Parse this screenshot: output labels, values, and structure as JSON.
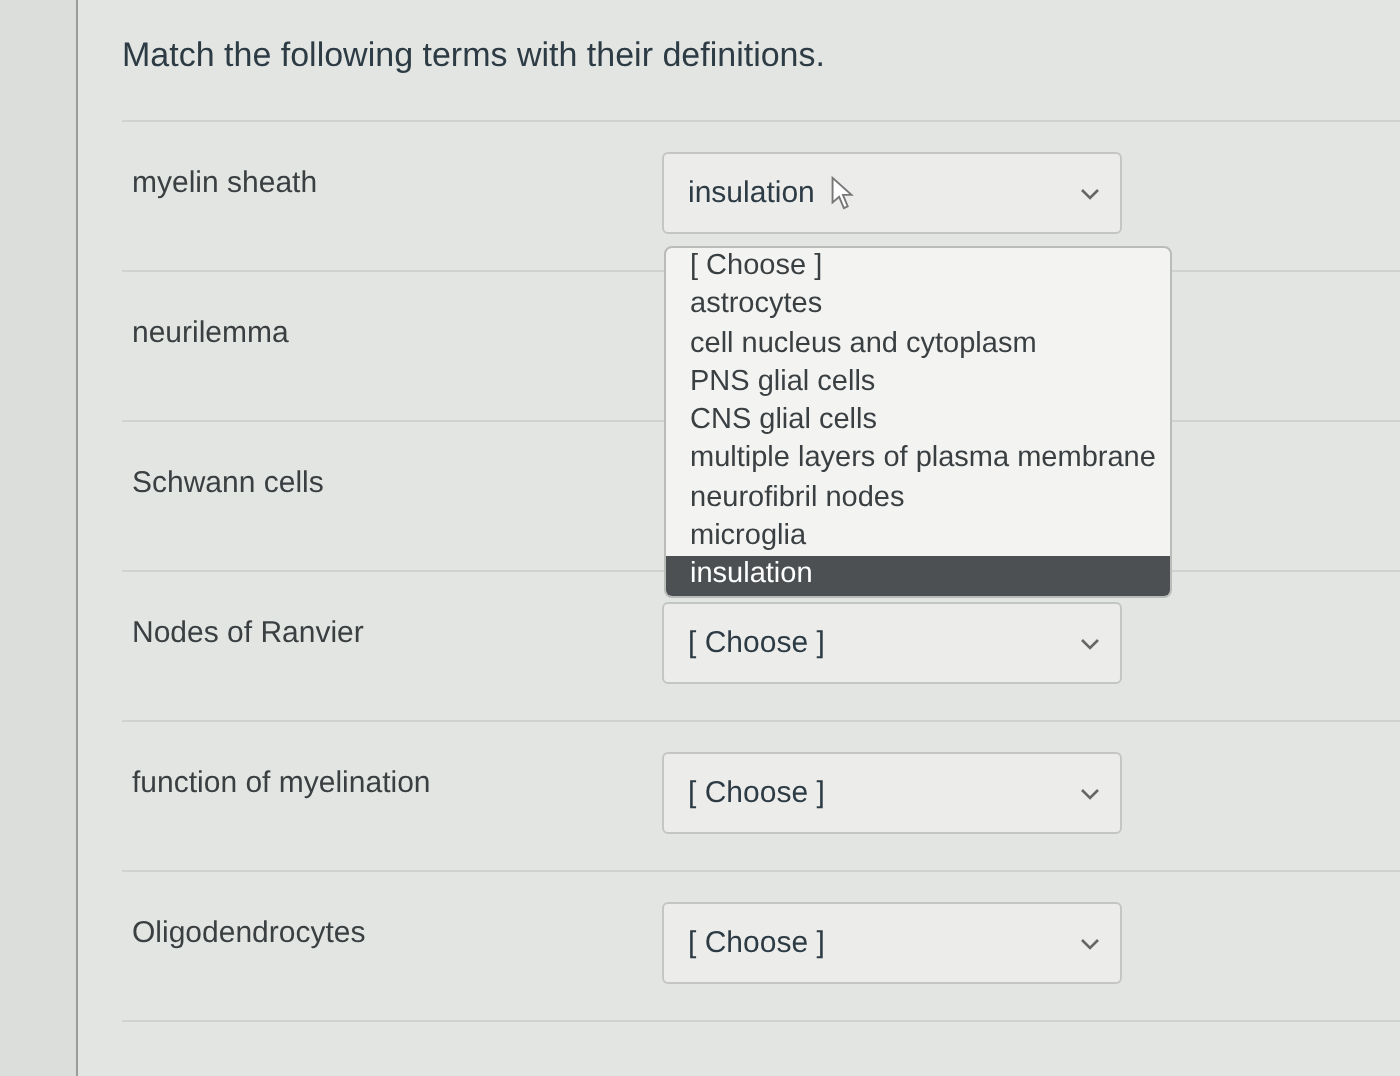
{
  "question": "Match the following terms with their definitions.",
  "rows": [
    {
      "term": "myelin sheath",
      "select": {
        "value": "insulation",
        "open": true,
        "options": [
          {
            "label": "[ Choose ]",
            "selected": false
          },
          {
            "label": "astrocytes",
            "selected": false
          },
          {
            "label": "cell nucleus and cytoplasm",
            "selected": false
          },
          {
            "label": "PNS glial cells",
            "selected": false
          },
          {
            "label": "CNS glial cells",
            "selected": false
          },
          {
            "label": "multiple layers of plasma membrane",
            "selected": false
          },
          {
            "label": "neurofibril nodes",
            "selected": false
          },
          {
            "label": "microglia",
            "selected": false
          },
          {
            "label": "insulation",
            "selected": true
          }
        ]
      }
    },
    {
      "term": "neurilemma"
    },
    {
      "term": "Schwann cells"
    },
    {
      "term": "Nodes of Ranvier",
      "select": {
        "value": "[ Choose ]",
        "open": false
      }
    },
    {
      "term": "function of myelination",
      "select": {
        "value": "[ Choose ]",
        "open": false
      }
    },
    {
      "term": "Oligodendrocytes",
      "select": {
        "value": "[ Choose ]",
        "open": false
      }
    }
  ]
}
